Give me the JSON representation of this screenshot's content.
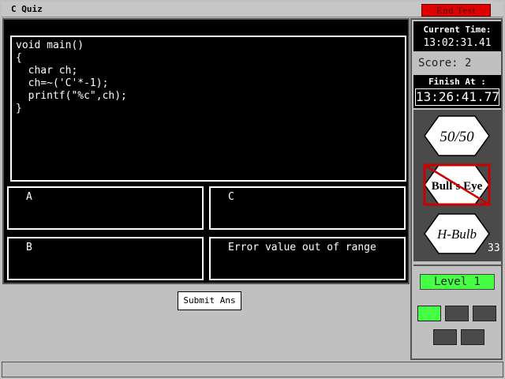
{
  "window": {
    "title": "C Quiz",
    "end_test_label": "End Test"
  },
  "question": {
    "code_lines": [
      "void main()",
      "{",
      "  char ch;",
      "  ch=~('C'*-1);",
      "  printf(\"%c\",ch);",
      "}"
    ]
  },
  "options": {
    "a": "A",
    "b": "B",
    "c": "C",
    "d": "Error value out of range"
  },
  "submit_label": "Submit Ans",
  "sidebar": {
    "current_time_label": "Current Time:",
    "current_time": "13:02:31.41",
    "score_label": "Score:",
    "score_value": "2",
    "finish_label": "Finish At :",
    "finish_time": "13:26:41.77",
    "lifelines": {
      "fifty": "50/50",
      "bulls_eye": "Bull's Eye",
      "hbulb": "H-Bulb",
      "hbulb_count": "33"
    },
    "level_label": "Level 1",
    "level_progress": {
      "total": 5,
      "completed": 1
    },
    "colors": {
      "level_active": "#44ff44",
      "level_inactive": "#4a4a4a",
      "end_test": "#e00000"
    }
  }
}
